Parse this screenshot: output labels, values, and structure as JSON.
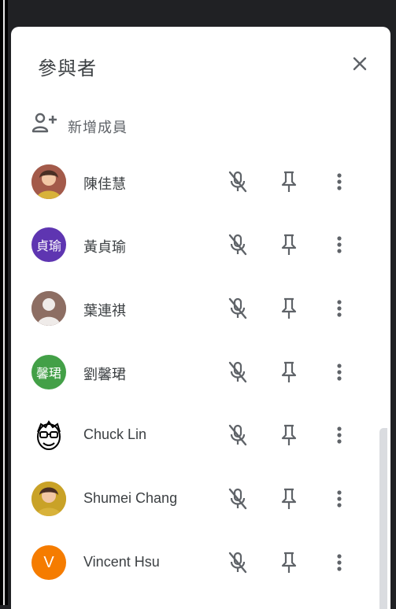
{
  "panel": {
    "title": "參與者",
    "close_icon": "close-icon"
  },
  "add_member": {
    "label": "新增成員",
    "icon": "person-add-icon"
  },
  "participants": [
    {
      "name": "陳佳慧",
      "avatar_type": "photo",
      "avatar_text": "",
      "avatar_color": "#a35a4a"
    },
    {
      "name": "黃貞瑜",
      "avatar_type": "text",
      "avatar_text": "貞瑜",
      "avatar_color": "#5e35b1"
    },
    {
      "name": "葉連祺",
      "avatar_type": "default",
      "avatar_text": "",
      "avatar_color": "#8d6e63"
    },
    {
      "name": "劉馨珺",
      "avatar_type": "text",
      "avatar_text": "馨珺",
      "avatar_color": "#43a047"
    },
    {
      "name": "Chuck Lin",
      "avatar_type": "drawing",
      "avatar_text": "",
      "avatar_color": "#ffffff"
    },
    {
      "name": "Shumei Chang",
      "avatar_type": "photo",
      "avatar_text": "",
      "avatar_color": "#c9a227"
    },
    {
      "name": "Vincent Hsu",
      "avatar_type": "letter",
      "avatar_text": "V",
      "avatar_color": "#f57c00"
    }
  ],
  "row_actions": {
    "mic_icon": "mic-off-icon",
    "pin_icon": "pin-icon",
    "more_icon": "more-vert-icon"
  },
  "colors": {
    "background": "#202124",
    "panel": "#ffffff",
    "text": "#3c4043",
    "icon": "#5f6368"
  }
}
